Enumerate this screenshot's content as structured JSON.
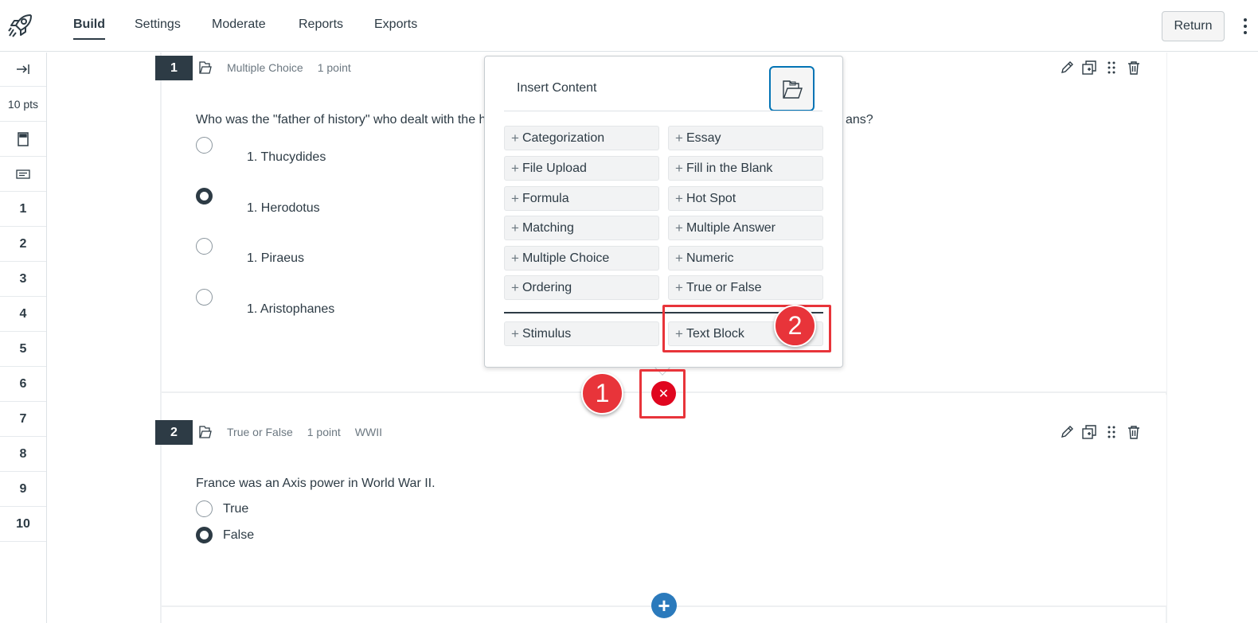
{
  "nav": {
    "tabs": [
      {
        "label": "Build",
        "active": true
      },
      {
        "label": "Settings",
        "active": false
      },
      {
        "label": "Moderate",
        "active": false
      },
      {
        "label": "Reports",
        "active": false
      },
      {
        "label": "Exports",
        "active": false
      }
    ],
    "return_label": "Return"
  },
  "rail": {
    "points": "10 pts",
    "numbers": [
      "1",
      "2",
      "3",
      "4",
      "5",
      "6",
      "7",
      "8",
      "9",
      "10"
    ]
  },
  "questions": [
    {
      "number": "1",
      "type": "Multiple Choice",
      "points": "1 point",
      "tag": "",
      "text_left": "Who was the \"father of history\" who dealt with the h",
      "text_right": "ans?",
      "choices": [
        {
          "label": "1. Thucydides",
          "selected": false
        },
        {
          "label": "1. Herodotus",
          "selected": true
        },
        {
          "label": "1. Piraeus",
          "selected": false
        },
        {
          "label": "1. Aristophanes",
          "selected": false
        }
      ]
    },
    {
      "number": "2",
      "type": "True or False",
      "points": "1 point",
      "tag": "WWII",
      "text": "France was an Axis power in World War II.",
      "choices": [
        {
          "label": "True",
          "selected": false
        },
        {
          "label": "False",
          "selected": true
        }
      ]
    }
  ],
  "insert_popover": {
    "title": "Insert Content",
    "items": [
      "Categorization",
      "Essay",
      "File Upload",
      "Fill in the Blank",
      "Formula",
      "Hot Spot",
      "Matching",
      "Multiple Answer",
      "Multiple Choice",
      "Numeric",
      "Ordering",
      "True or False"
    ],
    "extra_items": [
      "Stimulus",
      "Text Block"
    ]
  },
  "callouts": {
    "one": "1",
    "two": "2"
  },
  "colors": {
    "dark": "#2d3b45",
    "callout_red": "#e8343a",
    "close_red": "#e0061f",
    "add_blue": "#2b7abc",
    "focus_blue": "#0374b5"
  },
  "icons": {
    "logo": "rocket-icon",
    "expand": "arrow-to-right-icon",
    "close": "close-x-icon",
    "add": "plus-icon"
  }
}
